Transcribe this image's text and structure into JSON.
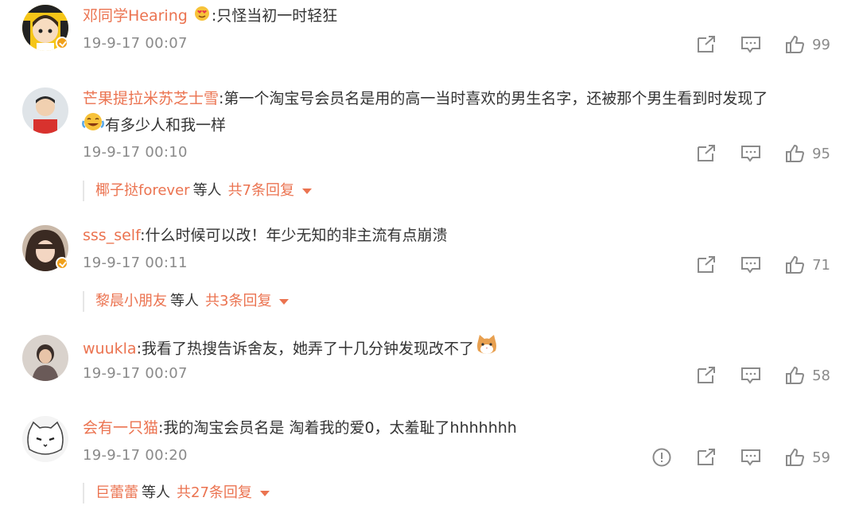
{
  "comments": [
    {
      "username": "邓同学Hearing",
      "text_before_emoji": ":",
      "text": "只怪当初一时轻狂",
      "text_line2": "",
      "timestamp": "19-9-17 00:07",
      "likes": "99",
      "verified": true,
      "inline_emoji": "heart-eyes-emoji"
    },
    {
      "username": "芒果提拉米苏芝士雪",
      "text": ":第一个淘宝号会员名是用的高一当时喜欢的男生名字，还被那个男生看到时发现了",
      "text_line2": "有多少人和我一样",
      "timestamp": "19-9-17 00:10",
      "likes": "95",
      "verified": false,
      "line2_emoji": "laugh-cry-emoji",
      "replies": {
        "names": "椰子挞forever",
        "etc": "等人",
        "count": "共7条回复"
      }
    },
    {
      "username": "sss_self",
      "text": ":什么时候可以改！年少无知的非主流有点崩溃",
      "timestamp": "19-9-17 00:11",
      "likes": "71",
      "verified": true,
      "replies": {
        "names": "黎晨小朋友",
        "etc": "等人",
        "count": "共3条回复"
      }
    },
    {
      "username": "wuukla",
      "text": ":我看了热搜告诉舍友，她弄了十几分钟发现改不了",
      "timestamp": "19-9-17 00:07",
      "likes": "58",
      "verified": false,
      "trailing_emoji": "cat-face-emoji"
    },
    {
      "username": "会有一只猫",
      "text": ":我的淘宝会员名是 淘着我的爱0，太羞耻了hhhhhhh",
      "timestamp": "19-9-17 00:20",
      "likes": "59",
      "verified": false,
      "has_report": true,
      "replies": {
        "names": "巨蕾蕾",
        "etc": "等人",
        "count": "共27条回复"
      }
    }
  ],
  "icons": {
    "repost": "repost-icon",
    "comment": "comment-icon",
    "like": "thumbs-up-icon",
    "report": "report-icon",
    "expand": "caret-down-icon"
  },
  "colors": {
    "username": "#eb7350",
    "timestamp": "#8a8a8a",
    "icon": "#8a8a8a",
    "verified": "#f0a01a"
  }
}
